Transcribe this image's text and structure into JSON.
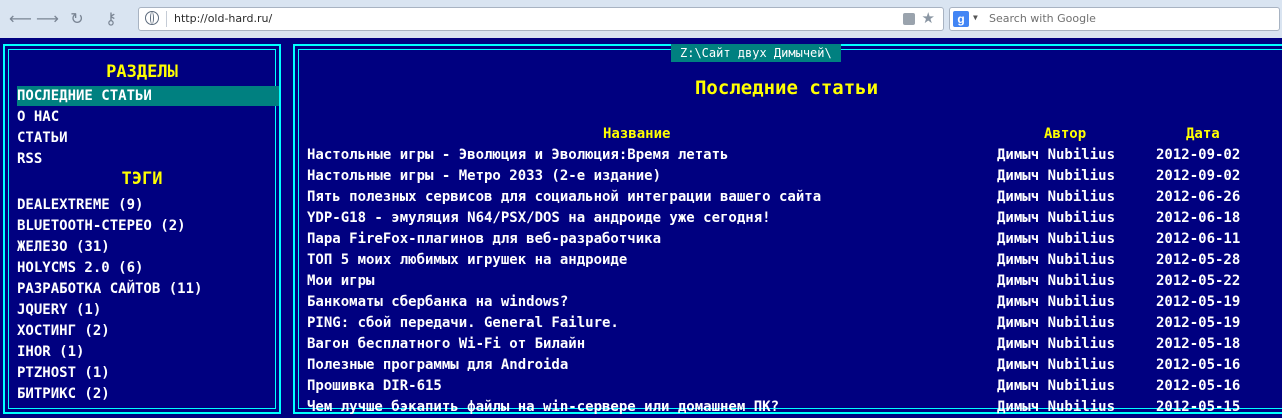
{
  "browser": {
    "url": "http://old-hard.ru/",
    "search_placeholder": "Search with Google"
  },
  "sidebar": {
    "sections_heading": "РАЗДЕЛЫ",
    "sections": [
      "ПОСЛЕДНИЕ СТАТЬИ",
      "О НАС",
      "СТАТЬИ",
      "RSS"
    ],
    "tags_heading": "ТЭГИ",
    "tags": [
      "DEALEXTREME (9)",
      "BLUETOOTH-СТЕРЕО (2)",
      "ЖЕЛЕЗО (31)",
      "HOLYCMS 2.0 (6)",
      "РАЗРАБОТКА САЙТОВ (11)",
      "JQUERY (1)",
      "ХОСТИНГ (2)",
      "IHOR (1)",
      "PTZHOST (1)",
      "БИТРИКС (2)"
    ]
  },
  "main": {
    "window_title": "Z:\\Сайт двух Димычей\\",
    "title": "Последние статьи",
    "columns": {
      "title": "Название",
      "author": "Автор",
      "date": "Дата"
    },
    "articles": [
      {
        "title": "Настольные игры - Эволюция и Эволюция:Время летать",
        "author": "Димыч Nubilius",
        "date": "2012-09-02"
      },
      {
        "title": "Настольные игры - Метро 2033 (2-е издание)",
        "author": "Димыч Nubilius",
        "date": "2012-09-02"
      },
      {
        "title": "Пять полезных сервисов для социальной интеграции вашего сайта",
        "author": "Димыч Nubilius",
        "date": "2012-06-26"
      },
      {
        "title": "YDP-G18 - эмуляция N64/PSX/DOS на андроиде уже сегодня!",
        "author": "Димыч Nubilius",
        "date": "2012-06-18"
      },
      {
        "title": "Пара FireFox-плагинов для веб-разработчика",
        "author": "Димыч Nubilius",
        "date": "2012-06-11"
      },
      {
        "title": "ТОП 5 моих любимых игрушек на андроиде",
        "author": "Димыч Nubilius",
        "date": "2012-05-28"
      },
      {
        "title": "Мои игры",
        "author": "Димыч Nubilius",
        "date": "2012-05-22"
      },
      {
        "title": "Банкоматы сбербанка на windows?",
        "author": "Димыч Nubilius",
        "date": "2012-05-19"
      },
      {
        "title": "PING: сбой передачи. General Failure.",
        "author": "Димыч Nubilius",
        "date": "2012-05-19"
      },
      {
        "title": "Вагон бесплатного Wi-Fi от Билайн",
        "author": "Димыч Nubilius",
        "date": "2012-05-18"
      },
      {
        "title": "Полезные программы для Androida",
        "author": "Димыч Nubilius",
        "date": "2012-05-16"
      },
      {
        "title": "Прошивка DIR-615",
        "author": "Димыч Nubilius",
        "date": "2012-05-16"
      },
      {
        "title": "Чем лучше бэкапить файлы на win-сервере или домашнем ПК?",
        "author": "Димыч Nubilius",
        "date": "2012-05-15"
      }
    ]
  }
}
